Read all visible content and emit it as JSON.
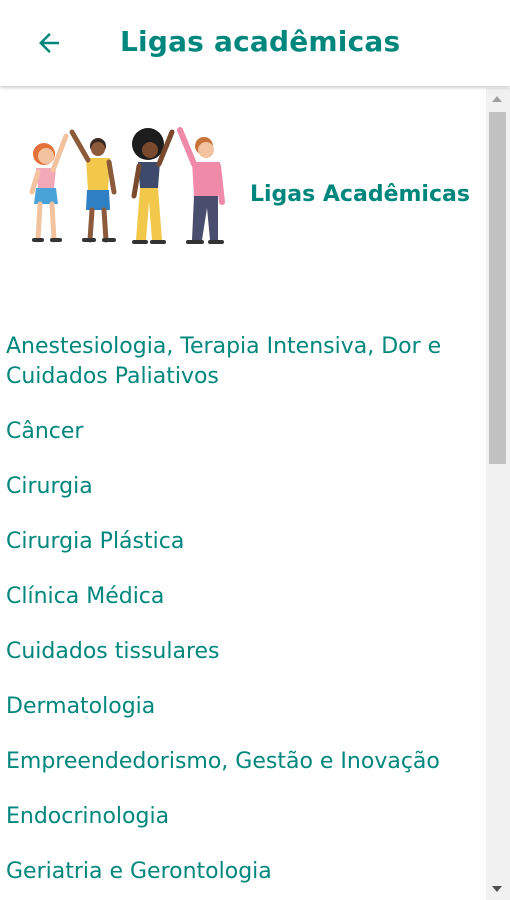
{
  "header": {
    "title": "Ligas acadêmicas",
    "back_icon": "arrow-left-icon"
  },
  "hero": {
    "title": "Ligas Acadêmicas",
    "illustration": "people-high-five-illustration"
  },
  "leagues": [
    "Anestesiologia, Terapia Intensiva, Dor e Cuidados Paliativos",
    "Câncer",
    "Cirurgia",
    "Cirurgia Plástica",
    "Clínica Médica",
    "Cuidados tissulares",
    "Dermatologia",
    "Empreendedorismo, Gestão e Inovação",
    "Endocrinologia",
    "Geriatria e Gerontologia"
  ],
  "colors": {
    "accent": "#00877d"
  }
}
